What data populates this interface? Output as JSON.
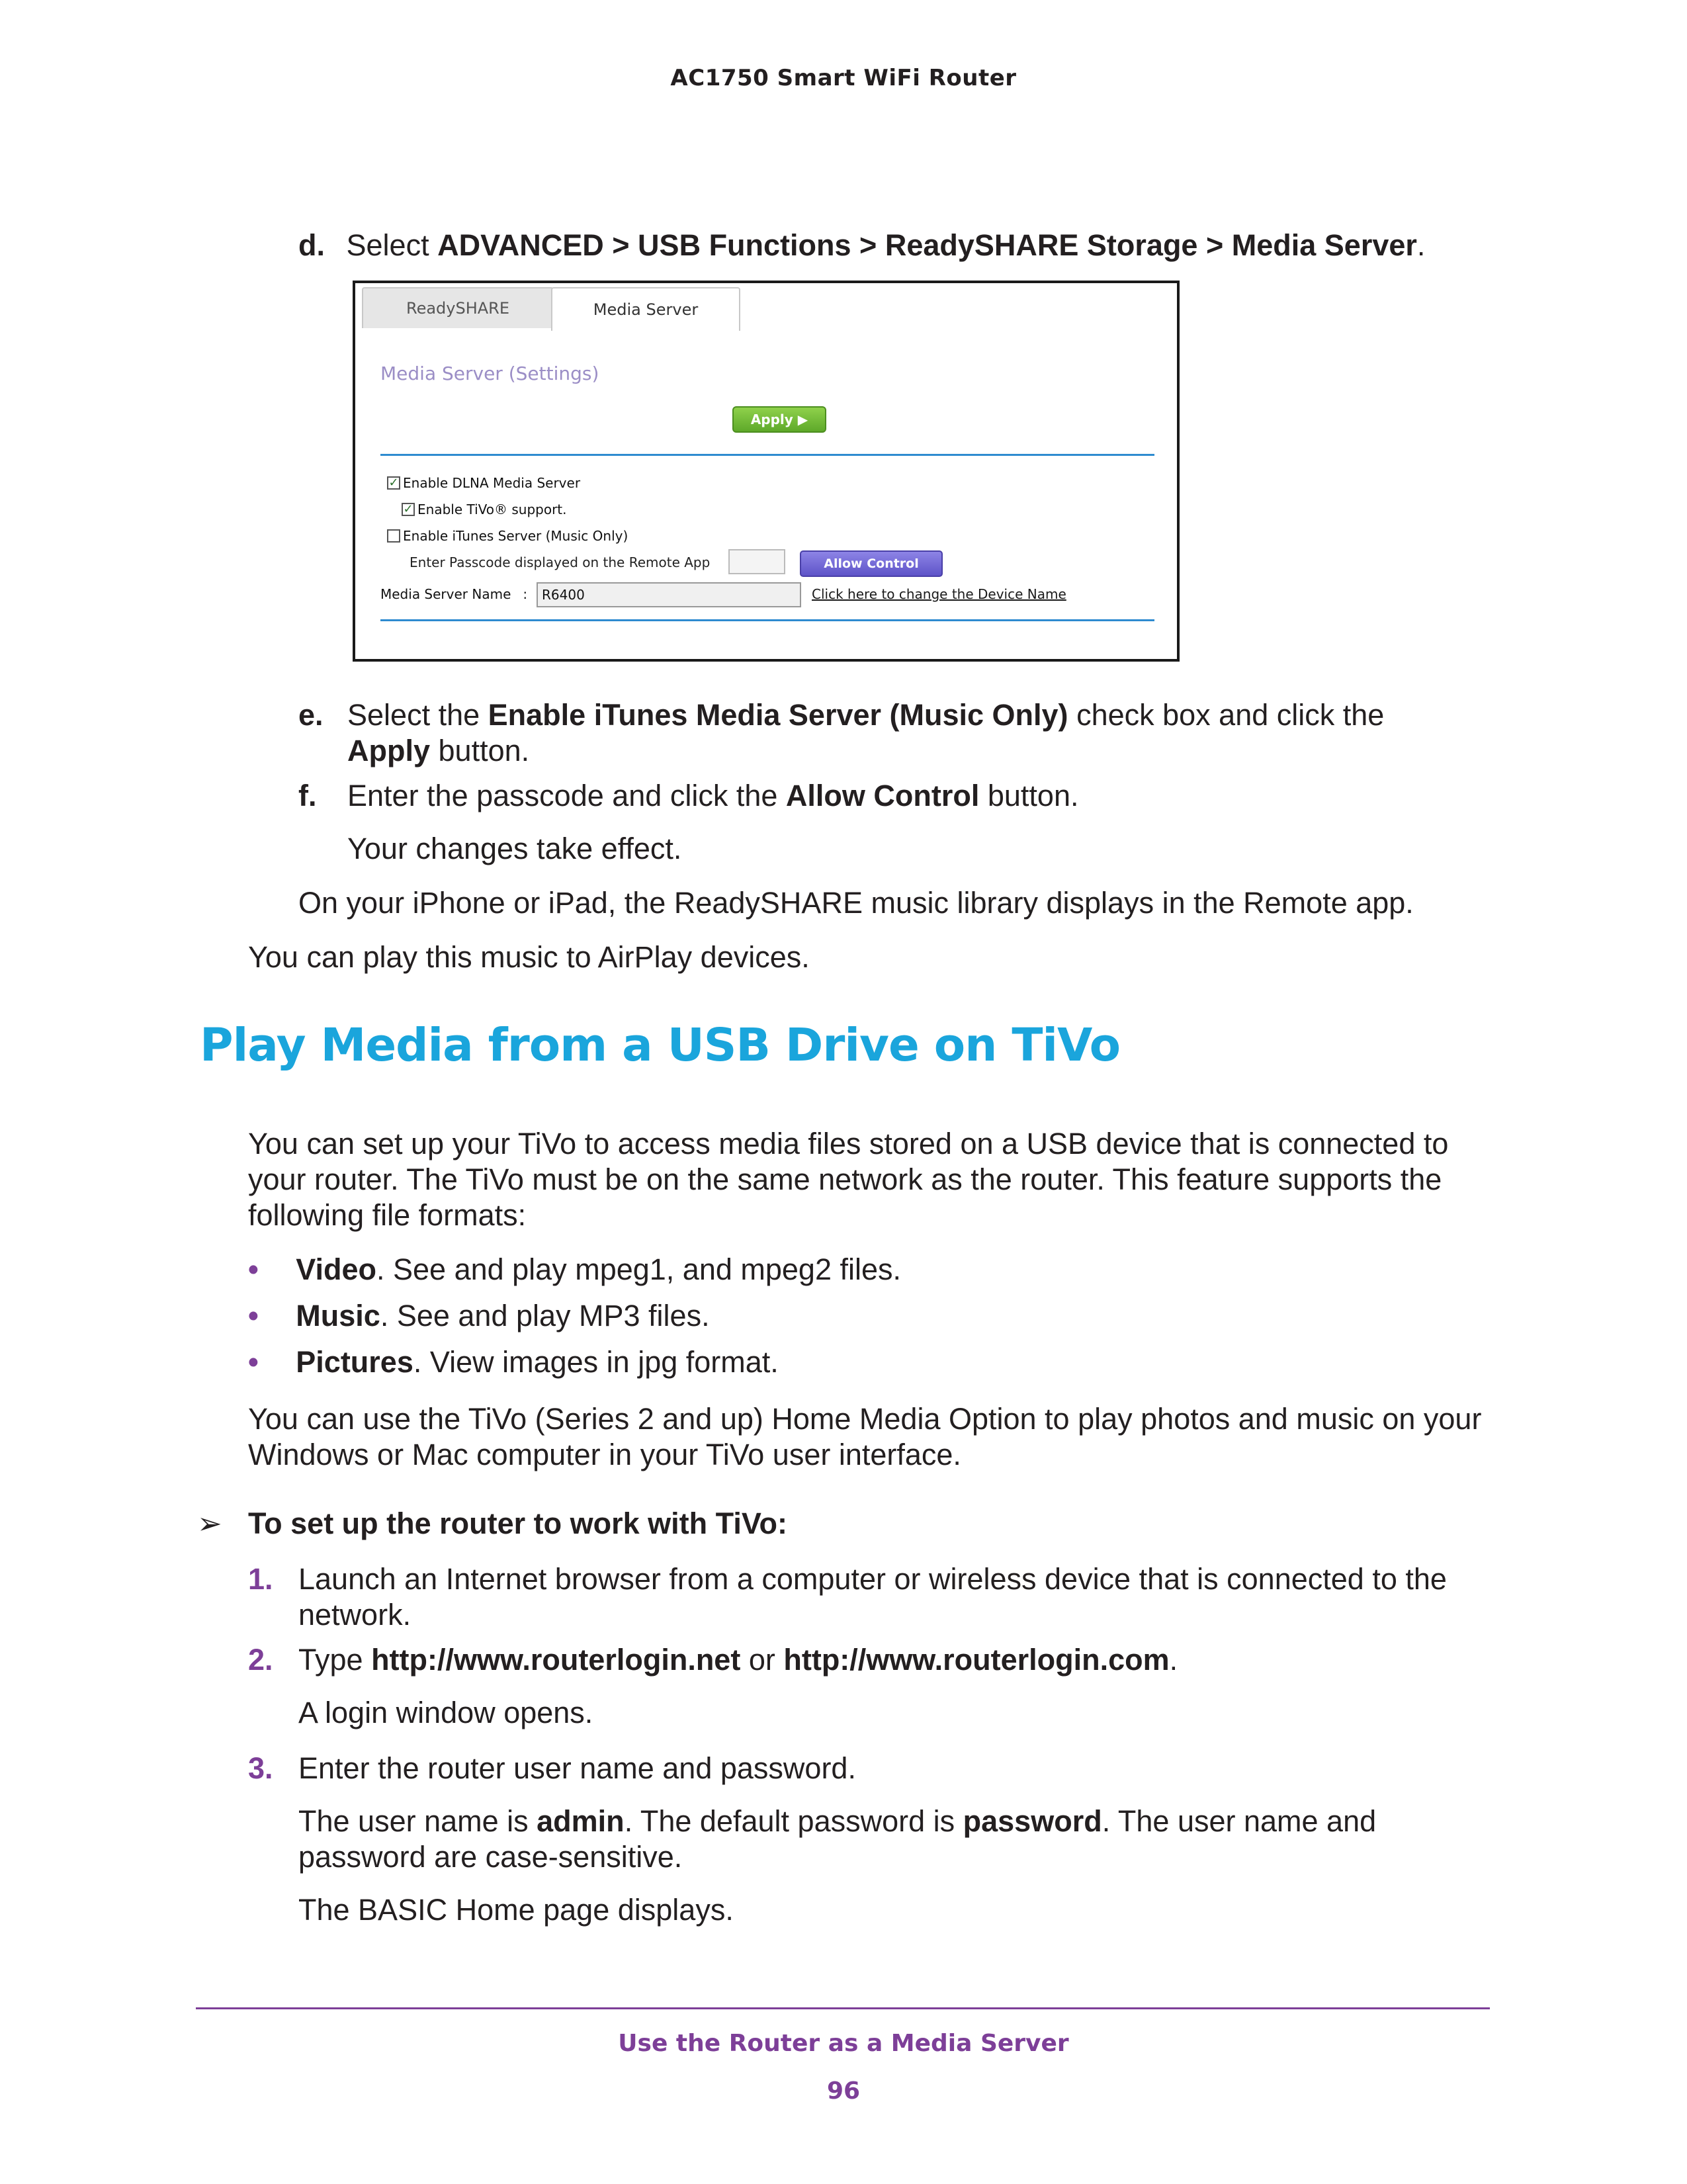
{
  "header": {
    "title": "AC1750 Smart WiFi Router"
  },
  "step_d": {
    "letter": "d.",
    "pre": "Select ",
    "path": "ADVANCED > USB Functions > ReadySHARE Storage > Media Server",
    "post": "."
  },
  "screenshot": {
    "tabs": [
      "ReadySHARE",
      "Media Server"
    ],
    "title": "Media Server (Settings)",
    "apply_label": "Apply ▶",
    "enable_dlna": {
      "label": "Enable DLNA Media Server",
      "checked": true
    },
    "enable_tivo": {
      "label": "Enable TiVo® support.",
      "checked": true
    },
    "enable_itunes": {
      "label": "Enable iTunes Server (Music Only)",
      "checked": false
    },
    "passcode_label": "Enter Passcode displayed on the Remote App",
    "passcode_value": "",
    "allow_label": "Allow Control",
    "name_label": "Media Server Name",
    "name_sep": ":",
    "name_value": "R6400",
    "name_link": "Click here to change the Device Name"
  },
  "step_e": {
    "letter": "e.",
    "pre": "Select the ",
    "bold1": "Enable iTunes Media Server (Music Only)",
    "mid": " check box and click the",
    "bold2": "Apply",
    "post": " button."
  },
  "step_f": {
    "letter": "f.",
    "pre": "Enter the passcode and click the ",
    "bold": "Allow Control",
    "post": " button."
  },
  "changes": "Your changes take effect.",
  "iphone_note": "On your iPhone or iPad, the ReadySHARE music library displays in the Remote app.",
  "airplay_note": "You can play this music to AirPlay devices.",
  "section": {
    "title": "Play Media from a USB Drive on TiVo",
    "intro_1": "You can set up your TiVo to access media files stored on a USB device that is connected to",
    "intro_2": "your router. The TiVo must be on the same network as the router. This feature supports the",
    "intro_3": "following file formats:",
    "bullets": [
      {
        "bold": "Video",
        "text": ". See and play mpeg1, and mpeg2 files."
      },
      {
        "bold": "Music",
        "text": ". See and play MP3 files."
      },
      {
        "bold": "Pictures",
        "text": ". View images in jpg format."
      }
    ],
    "bullet_char": "•",
    "para2_1": "You can use the TiVo (Series 2 and up) Home Media Option to play photos and music on your",
    "para2_2": "Windows or Mac computer in your TiVo user interface."
  },
  "procedure": {
    "arrow": "➢",
    "heading": "To set up the router to work with TiVo:",
    "step1_num": "1.",
    "step1_line1": "Launch an Internet browser from a computer or wireless device that is connected to the",
    "step1_line2": "network.",
    "step2_num": "2.",
    "step2_pre": "Type ",
    "step2_url1": "http://www.routerlogin.net",
    "step2_or": " or ",
    "step2_url2": "http://www.routerlogin.com",
    "step2_post": ".",
    "step2_note": "A login window opens.",
    "step3_num": "3.",
    "step3_text": "Enter the router user name and password.",
    "step3_p_pre": "The user name is ",
    "step3_p_user": "admin",
    "step3_p_mid": ". The default password is ",
    "step3_p_pass": "password",
    "step3_p_post": ". The user name and",
    "step3_p_line2": "password are case-sensitive.",
    "step3_note": "The BASIC Home page displays."
  },
  "footer": {
    "title": "Use the Router as a Media Server",
    "page": "96"
  }
}
